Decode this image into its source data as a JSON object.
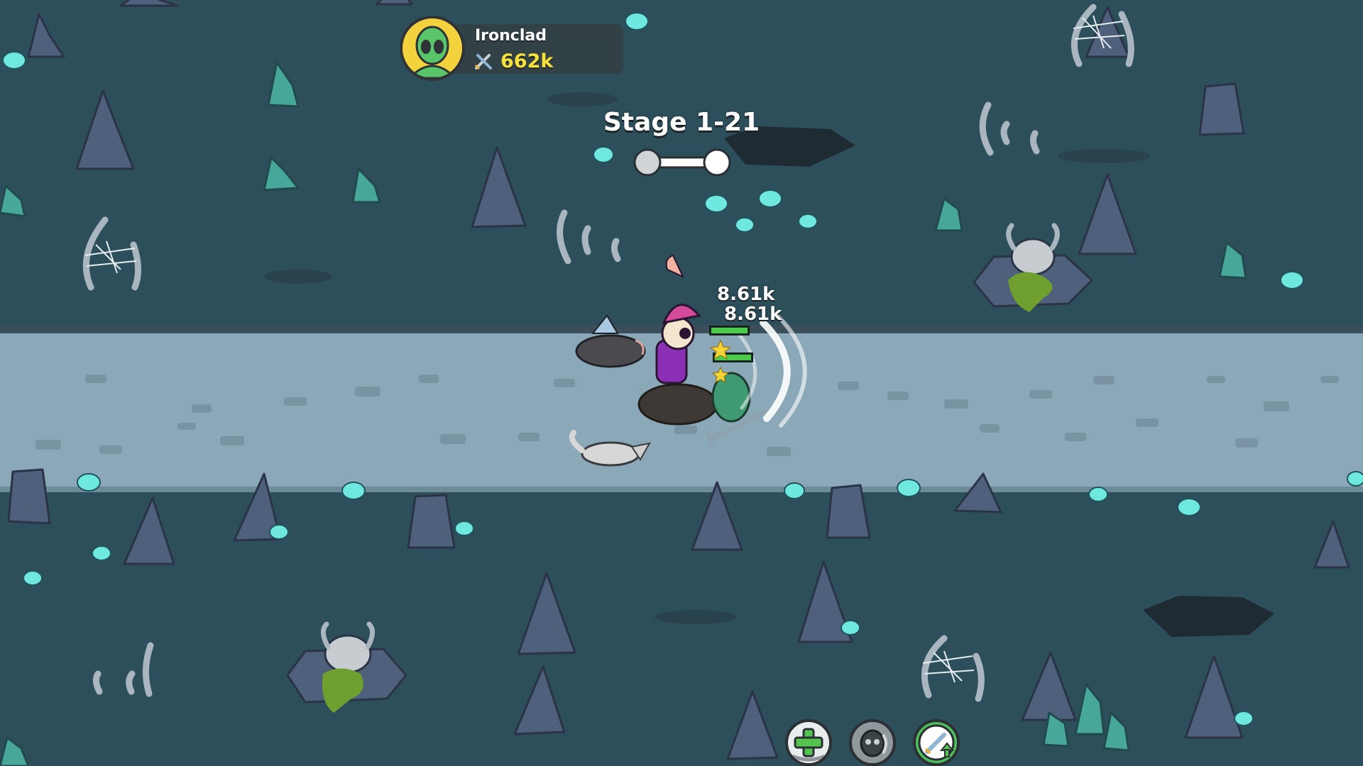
{
  "player": {
    "name": "Ironclad",
    "power": "662k",
    "avatar_icon": "alien-avatar-icon",
    "power_icon": "crossed-swords-icon"
  },
  "stage": {
    "label": "Stage 1-21",
    "progress_nodes": 2,
    "current_node": 2
  },
  "combat": {
    "damage_numbers": [
      "8.61k",
      "8.61k"
    ]
  },
  "skills": [
    {
      "name": "heal-skill",
      "icon": "green-cross-icon"
    },
    {
      "name": "summon-skill",
      "icon": "ghost-skull-icon"
    },
    {
      "name": "attack-boost-skill",
      "icon": "sword-up-arrow-icon"
    }
  ],
  "colors": {
    "background": "#2c4f5b",
    "road": "#8aa8b7",
    "power_text": "#f6e03a",
    "hp_bar": "#4ecb4a",
    "mushroom_glow": "#6fe8e0"
  }
}
